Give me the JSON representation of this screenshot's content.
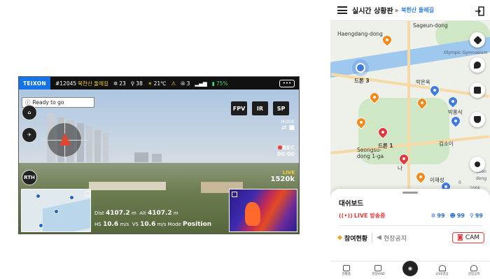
{
  "drone_screen": {
    "brand": "TEIXON",
    "mission_id": "#12045",
    "mission_name": "북한산 둘레길",
    "satellites": "23",
    "gps_count": "38",
    "temperature": "21℃",
    "drone_count": "3",
    "battery": "75%",
    "status": "Ready to go",
    "mode_buttons": [
      "FPV",
      "IR",
      "SP"
    ],
    "mode_label": "MODE",
    "rec_label": "REC",
    "rec_time": "00:00",
    "live_label": "LIVE",
    "bitrate": "1520k",
    "side_buttons": [
      "RTH"
    ],
    "dist_label": "Dist",
    "dist_value": "4107.2",
    "dist_unit": "m",
    "alt_label": "Alt",
    "alt_value": "4107.2",
    "alt_unit": "m",
    "hs_label": "HS",
    "hs_value": "10.6",
    "vs_label": "VS",
    "vs_value": "10.6",
    "speed_unit": "m/s",
    "mode_text": "Mode",
    "position_text": "Position"
  },
  "app": {
    "title": "실시간 상황판",
    "breadcrumb": "북한산 둘레길",
    "map_labels": {
      "haengdang": "Haengdang-dong",
      "sageun": "Sageun-dong",
      "olympic": "Olympic Gymnasium",
      "drone3": "드론 3",
      "drone1": "드론 1",
      "seongsu": "Seongsu-dong 1-ga",
      "park": "박은옥",
      "hongsik": "박홍식",
      "kimsoi": "김소이",
      "na": "나",
      "leejaesung": "이재성",
      "seong": "Seon",
      "dong": "dong",
      "zero": "0",
      "hundred": "100k"
    },
    "dashboard": {
      "title": "대쉬보드",
      "live_text": "LIVE 방송중",
      "counts": [
        "99",
        "99",
        "99"
      ]
    },
    "tabs": {
      "participation": "참여현황",
      "notice": "현장공지",
      "cam": "CAM"
    },
    "nav": [
      "현황홈",
      "현장VOD",
      "LIVE영상",
      "현장공지"
    ]
  },
  "colors": {
    "brand_blue": "#1473e6",
    "live_red": "#e33b3b",
    "link_blue": "#2a7de1",
    "pin_orange": "#f48a1b"
  }
}
